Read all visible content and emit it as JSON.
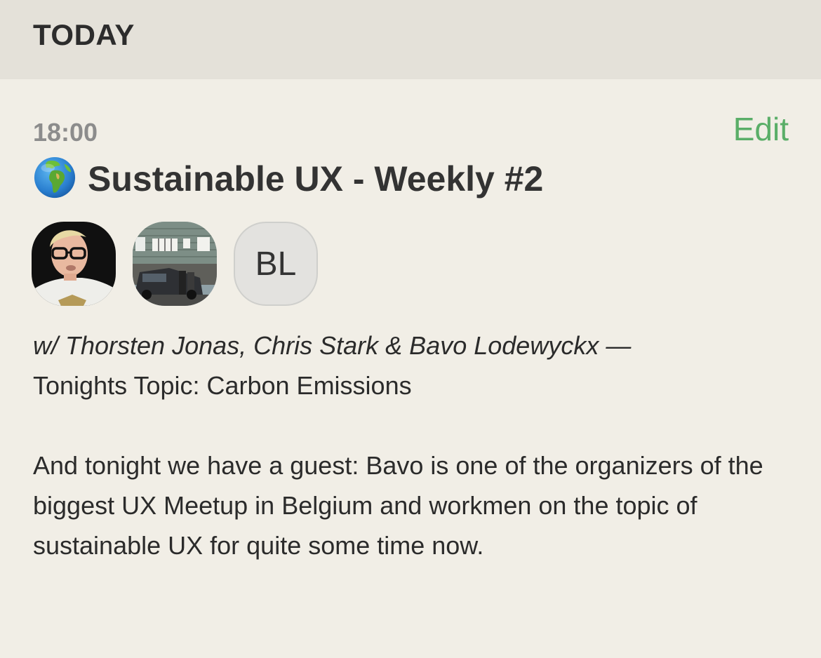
{
  "section": {
    "title": "TODAY"
  },
  "event": {
    "time": "18:00",
    "edit_label": "Edit",
    "title_icon": "globe-europe-africa-icon",
    "title": "Sustainable UX - Weekly #2",
    "attendees": [
      {
        "name": "attendee-1",
        "kind": "photo"
      },
      {
        "name": "attendee-2",
        "kind": "photo"
      },
      {
        "name": "attendee-3",
        "kind": "initials",
        "initials": "BL"
      }
    ],
    "description": {
      "with_line": "w/ Thorsten Jonas, Chris Stark & Bavo Lodewyckx —",
      "topic_line": "Tonights Topic: Carbon Emissions",
      "paragraph": "And tonight we have a guest: Bavo is one of the organizers of the biggest UX Meetup in Belgium and workmen on the topic of sustainable UX for quite some time now."
    }
  },
  "colors": {
    "background": "#f1eee6",
    "header_background": "#e4e1d9",
    "accent": "#5aae68"
  }
}
